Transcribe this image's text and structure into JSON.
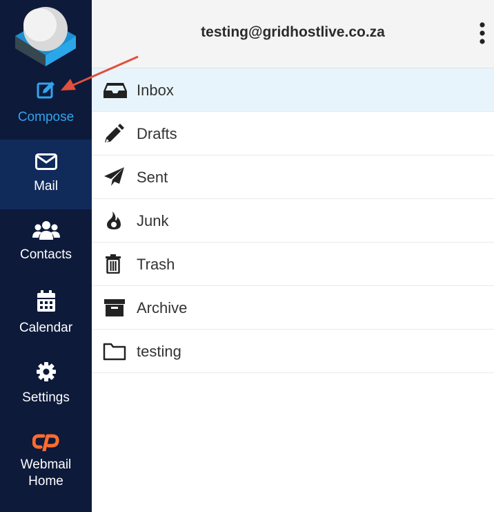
{
  "account": {
    "email": "testing@gridhostlive.co.za"
  },
  "nav": {
    "compose": "Compose",
    "mail": "Mail",
    "contacts": "Contacts",
    "calendar": "Calendar",
    "settings": "Settings",
    "webmail_home": "Webmail Home"
  },
  "folders": [
    {
      "name": "Inbox",
      "icon": "inbox-icon"
    },
    {
      "name": "Drafts",
      "icon": "pencil-icon"
    },
    {
      "name": "Sent",
      "icon": "paper-plane-icon"
    },
    {
      "name": "Junk",
      "icon": "fire-icon"
    },
    {
      "name": "Trash",
      "icon": "trash-icon"
    },
    {
      "name": "Archive",
      "icon": "archive-icon"
    },
    {
      "name": "testing",
      "icon": "folder-icon"
    }
  ],
  "colors": {
    "sidebar": "#0d1a3a",
    "sidebar_active": "#102a5a",
    "compose_accent": "#30a5ee",
    "selected_row": "#e8f4fb",
    "annotation_arrow": "#e0503c",
    "cpanel_orange": "#ff6c2c"
  }
}
